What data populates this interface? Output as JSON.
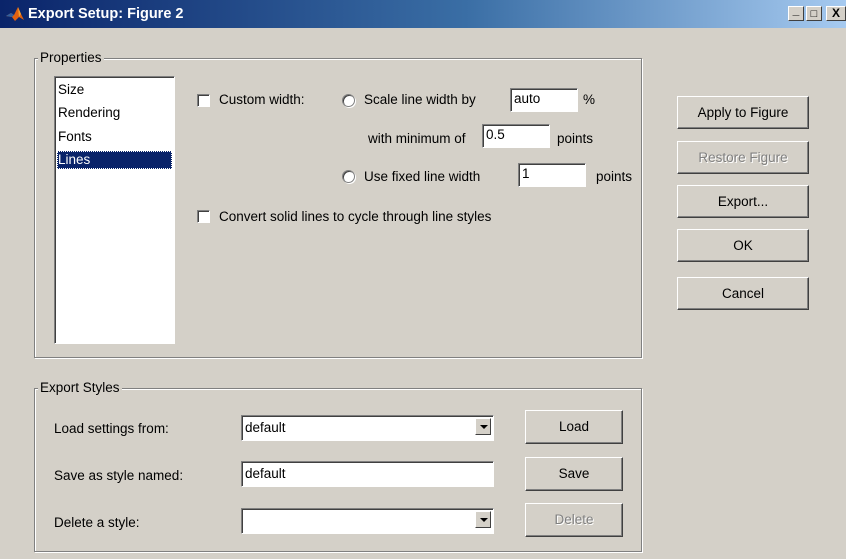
{
  "window": {
    "title": "Export Setup: Figure 2",
    "controls": [
      "_",
      "□",
      "X"
    ]
  },
  "properties": {
    "legend": "Properties",
    "items": [
      {
        "label": "Size",
        "selected": false
      },
      {
        "label": "Rendering",
        "selected": false
      },
      {
        "label": "Fonts",
        "selected": false
      },
      {
        "label": "Lines",
        "selected": true
      }
    ],
    "custom_width_label": "Custom width:",
    "custom_width_checked": false,
    "scale_label": "Scale line width by",
    "scale_value": "auto",
    "scale_unit": "%",
    "min_label": "with minimum of",
    "min_value": "0.5",
    "min_unit": "points",
    "fixed_label": "Use fixed line width",
    "fixed_value": "1",
    "fixed_unit": "points",
    "convert_label": "Convert solid lines to cycle through line styles",
    "convert_checked": false
  },
  "side_buttons": {
    "apply": "Apply to Figure",
    "restore": "Restore Figure",
    "export": "Export...",
    "ok": "OK",
    "cancel": "Cancel"
  },
  "export_styles": {
    "legend": "Export Styles",
    "load_label": "Load settings from:",
    "load_value": "default",
    "load_button": "Load",
    "save_label": "Save as style named:",
    "save_value": "default",
    "save_button": "Save",
    "delete_label": "Delete a style:",
    "delete_value": "",
    "delete_button": "Delete"
  },
  "colors": {
    "titlebar_start": "#0a246a",
    "titlebar_end": "#a6caf0",
    "face": "#d4d0c8",
    "selection": "#0a246a"
  }
}
